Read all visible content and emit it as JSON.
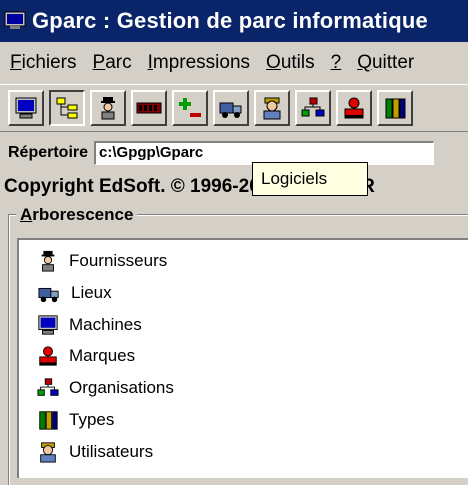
{
  "window": {
    "title": "Gparc : Gestion de parc informatique"
  },
  "menu": {
    "items": [
      {
        "mnemonic": "F",
        "rest": "ichiers"
      },
      {
        "mnemonic": "P",
        "rest": "arc"
      },
      {
        "mnemonic": "I",
        "rest": "mpressions"
      },
      {
        "mnemonic": "O",
        "rest": "utils"
      },
      {
        "mnemonic": "?",
        "rest": ""
      },
      {
        "mnemonic": "Q",
        "rest": "uitter"
      }
    ]
  },
  "toolbar": {
    "buttons": [
      {
        "icon": "monitor-icon"
      },
      {
        "icon": "tree-icon",
        "pressed": true
      },
      {
        "icon": "supplier-icon"
      },
      {
        "icon": "memory-icon"
      },
      {
        "icon": "add-remove-icon"
      },
      {
        "icon": "truck-icon"
      },
      {
        "icon": "user-icon"
      },
      {
        "icon": "organisations-icon"
      },
      {
        "icon": "brands-icon"
      },
      {
        "icon": "book-icon"
      }
    ]
  },
  "repertoire": {
    "label": "Répertoire",
    "value": "c:\\Gpgp\\Gparc"
  },
  "copyright": {
    "text": "Copyright EdSoft. © 1996-2002 - IDDN.FR"
  },
  "tooltip": {
    "text": "Logiciels"
  },
  "arborescence": {
    "label_mnemonic": "A",
    "label_rest": "rborescence",
    "items": [
      {
        "label": "Fournisseurs",
        "icon": "supplier-icon"
      },
      {
        "label": "Lieux",
        "icon": "truck-icon"
      },
      {
        "label": "Machines",
        "icon": "monitor-icon"
      },
      {
        "label": "Marques",
        "icon": "brands-icon"
      },
      {
        "label": "Organisations",
        "icon": "organisations-icon"
      },
      {
        "label": "Types",
        "icon": "book-icon"
      },
      {
        "label": "Utilisateurs",
        "icon": "user-icon"
      }
    ]
  },
  "colors": {
    "titlebar": "#0a246a",
    "face": "#d4d0c8",
    "tooltip": "#ffffe1"
  }
}
